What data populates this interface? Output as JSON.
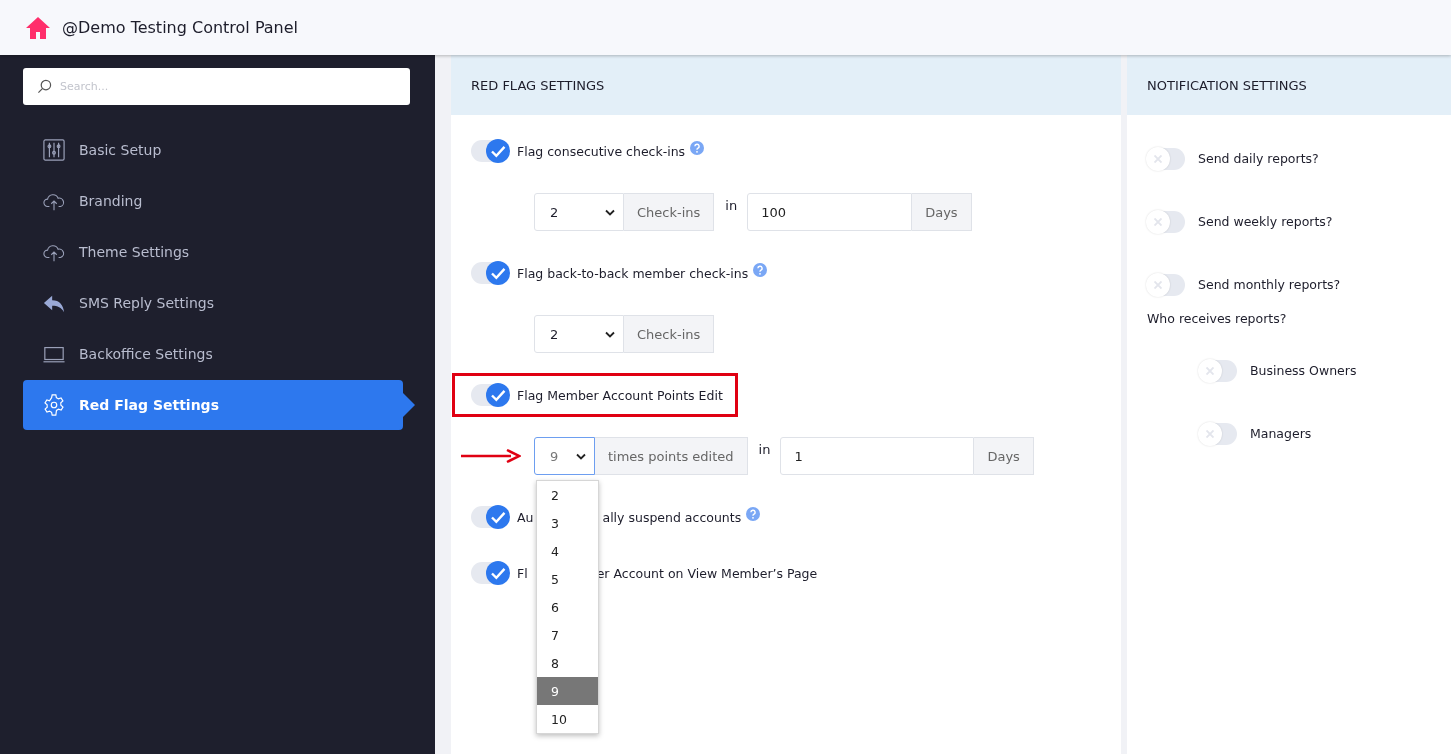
{
  "header": {
    "title": "@Demo Testing Control Panel"
  },
  "sidebar": {
    "search": {
      "placeholder": "Search..."
    },
    "items": [
      {
        "label": "Basic Setup",
        "selected": false
      },
      {
        "label": "Branding",
        "selected": false
      },
      {
        "label": "Theme Settings",
        "selected": false
      },
      {
        "label": "SMS Reply Settings",
        "selected": false
      },
      {
        "label": "Backoffice Settings",
        "selected": false
      },
      {
        "label": "Red Flag Settings",
        "selected": true
      }
    ]
  },
  "red_flag": {
    "title": "RED FLAG SETTINGS",
    "items": [
      {
        "kind": "toggle",
        "on": true,
        "label_parts": [
          "Flag consecutive check-ins"
        ],
        "help": true,
        "highlighted": false
      },
      {
        "kind": "inputs",
        "select_value": "2",
        "unit": "Check-ins",
        "connector": "in",
        "number": "100",
        "suffix": "Days",
        "focused": false,
        "arrow": false
      },
      {
        "kind": "toggle",
        "on": true,
        "label_parts": [
          "Flag back-to-back member check-ins"
        ],
        "help": true,
        "highlighted": false
      },
      {
        "kind": "inputs",
        "select_value": "2",
        "unit": "Check-ins",
        "focused": false,
        "arrow": false
      },
      {
        "kind": "toggle",
        "on": true,
        "label_parts": [
          "Flag Member Account Points Edit"
        ],
        "help": false,
        "highlighted": true
      },
      {
        "kind": "inputs",
        "select_value": "9",
        "unit": "times points edited",
        "connector": "in",
        "number": "1",
        "suffix": "Days",
        "focused": true,
        "arrow": true,
        "options": [
          {
            "label": "2",
            "selected": false
          },
          {
            "label": "3",
            "selected": false
          },
          {
            "label": "4",
            "selected": false
          },
          {
            "label": "5",
            "selected": false
          },
          {
            "label": "6",
            "selected": false
          },
          {
            "label": "7",
            "selected": false
          },
          {
            "label": "8",
            "selected": false
          },
          {
            "label": "9",
            "selected": true
          },
          {
            "label": "10",
            "selected": false
          }
        ]
      },
      {
        "kind": "toggle",
        "on": true,
        "label_parts": [
          "Au",
          "ally suspend accounts"
        ],
        "help": true,
        "highlighted": false
      },
      {
        "kind": "toggle",
        "on": true,
        "label_parts": [
          "Fl",
          "er Account on View Member’s Page"
        ],
        "help": false,
        "highlighted": false
      }
    ]
  },
  "notifications": {
    "title": "NOTIFICATION SETTINGS",
    "items": [
      {
        "kind": "toggle",
        "on": false,
        "label": "Send daily reports?"
      },
      {
        "kind": "toggle",
        "on": false,
        "label": "Send weekly reports?"
      },
      {
        "kind": "toggle",
        "on": false,
        "label": "Send monthly reports?"
      },
      {
        "kind": "heading",
        "label": "Who receives reports?"
      },
      {
        "kind": "subtoggle",
        "on": false,
        "label": "Business Owners"
      },
      {
        "kind": "subtoggle",
        "on": false,
        "label": "Managers"
      }
    ]
  }
}
